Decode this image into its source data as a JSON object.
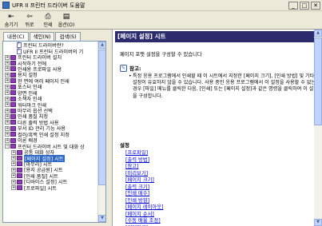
{
  "window": {
    "title": "UFR II 프린터 드라이버 도움말",
    "min": "_",
    "max": "□",
    "close": "✕"
  },
  "toolbar": {
    "buttons": [
      {
        "label": "숨기기",
        "icon": "hide-icon",
        "glyph": "⇤"
      },
      {
        "label": "뒤로",
        "icon": "back-icon",
        "glyph": "⇦"
      },
      {
        "label": "인쇄",
        "icon": "print-icon",
        "glyph": "⎙"
      },
      {
        "label": "옵션(O)",
        "icon": "options-icon",
        "glyph": "▤"
      }
    ]
  },
  "tabs": [
    "내용(C)",
    "색인(N)",
    "검색(S)"
  ],
  "tree": [
    {
      "label": "프린터 드라이버란?",
      "type": "page",
      "depth": 1
    },
    {
      "label": "UFR II 프린터 드라이버의 기",
      "type": "page",
      "depth": 1
    },
    {
      "label": "프린터 드라이버 설치",
      "type": "book",
      "depth": 0
    },
    {
      "label": "시작하기 전에",
      "type": "book",
      "depth": 0
    },
    {
      "label": "인쇄용 프로파일 사용",
      "type": "book",
      "depth": 0
    },
    {
      "label": "용지 설정",
      "type": "book",
      "depth": 0
    },
    {
      "label": "한 면에 여러 페이지 인쇄",
      "type": "book",
      "depth": 0
    },
    {
      "label": "포스터 인쇄",
      "type": "book",
      "depth": 0
    },
    {
      "label": "양면 인쇄",
      "type": "book",
      "depth": 0
    },
    {
      "label": "소책자 인쇄",
      "type": "book",
      "depth": 0
    },
    {
      "label": "워터마크 인쇄",
      "type": "book",
      "depth": 0
    },
    {
      "label": "마무리 옵션 선택",
      "type": "book",
      "depth": 0
    },
    {
      "label": "인쇄 품질 지정",
      "type": "book",
      "depth": 0
    },
    {
      "label": "다른 출력 방법 사용",
      "type": "book",
      "depth": 0
    },
    {
      "label": "부서 ID 관리 기능 사용",
      "type": "book",
      "depth": 0
    },
    {
      "label": "컬러/흑백 인쇄 설정 지정",
      "type": "book",
      "depth": 0
    },
    {
      "label": "이론 배경",
      "type": "book",
      "depth": 0
    },
    {
      "label": "프린터 드라이버 시트 및 대화 상",
      "type": "book",
      "depth": 0,
      "open": true
    },
    {
      "label": "공통 대화 상자",
      "type": "book",
      "depth": 1
    },
    {
      "label": "[페이지 설정] 시트",
      "type": "book",
      "depth": 1,
      "selected": true
    },
    {
      "label": "[마무리] 시트",
      "type": "book",
      "depth": 1
    },
    {
      "label": "[용지 공급원] 시트",
      "type": "book",
      "depth": 1
    },
    {
      "label": "[인쇄 품질] 시트",
      "type": "book",
      "depth": 1
    },
    {
      "label": "[디바이스 설정] 시트",
      "type": "book",
      "depth": 1
    },
    {
      "label": "[프로파일] 시트",
      "type": "book",
      "depth": 1
    }
  ],
  "content": {
    "header": "[페이지 설정] 시트",
    "intro": "페이지 포맷 설정을 구성할 수 있습니다",
    "note_title": "참고:",
    "note_items": [
      "특정 응용 프로그램에서 인쇄할 때 이 시트에서 지정한 [페이지 크기], [인쇄 방법] 및 기타 설정이 유효하지 않을 수 있습니다. 사용 중인 응용 프로그램에서 이 설정을 사용할 수 없는 경우 [파일] 메뉴를 클릭한 다음, [인쇄] 또는 [페이지 설정]과 같은 명령을 클릭하여 이 설정을 구성합니다."
    ],
    "settings_title": "설정",
    "links": [
      "[프로파일]",
      "[출력 방법]",
      "[참고]",
      "[미리보기]",
      "[페이지 크기]",
      "[출력 크기]",
      "[인쇄 매수]",
      "[인쇄 방향]",
      "[페이지 레이아웃]",
      "[페이지 순서]",
      "[수동 배율 조정]",
      "[워터마크]"
    ]
  }
}
